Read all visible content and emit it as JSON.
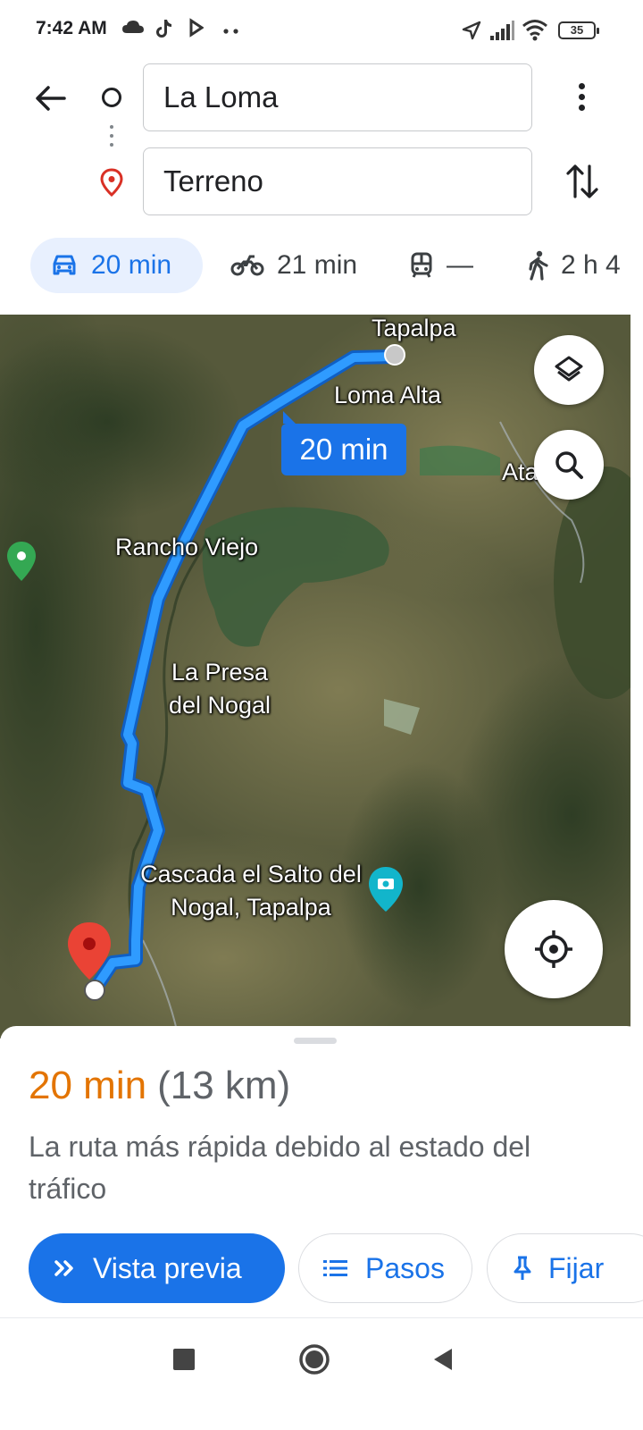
{
  "status_bar": {
    "time": "7:42 AM",
    "battery": "35",
    "icons": [
      "cloud-icon",
      "tiktok-icon",
      "play-icon",
      "more-dots-icon",
      "location-arrow-icon",
      "signal-icon",
      "wifi-icon",
      "battery-icon"
    ]
  },
  "route": {
    "origin": "La Loma",
    "destination": "Terreno"
  },
  "modes": [
    {
      "label": "20 min",
      "icon": "car-icon",
      "active": true
    },
    {
      "label": "21 min",
      "icon": "motorcycle-icon"
    },
    {
      "label": "—",
      "icon": "transit-icon"
    },
    {
      "label": "2 h 4",
      "icon": "walk-icon"
    }
  ],
  "map": {
    "labels": [
      "Tapalpa",
      "Loma Alta",
      "Ata",
      "Rancho Viejo",
      "La Presa del Nogal",
      "Cascada el Salto del Nogal, Tapalpa"
    ],
    "route_badge": "20 min",
    "route_color": "#1a73e8"
  },
  "sheet": {
    "time": "20 min",
    "distance": "(13 km)",
    "reason": "La ruta más rápida debido al estado del tráfico",
    "preview_label": "Vista previa",
    "steps_label": "Pasos",
    "pin_label": "Fijar"
  },
  "colors": {
    "accent": "#1a73e8",
    "time_orange": "#e37400"
  }
}
